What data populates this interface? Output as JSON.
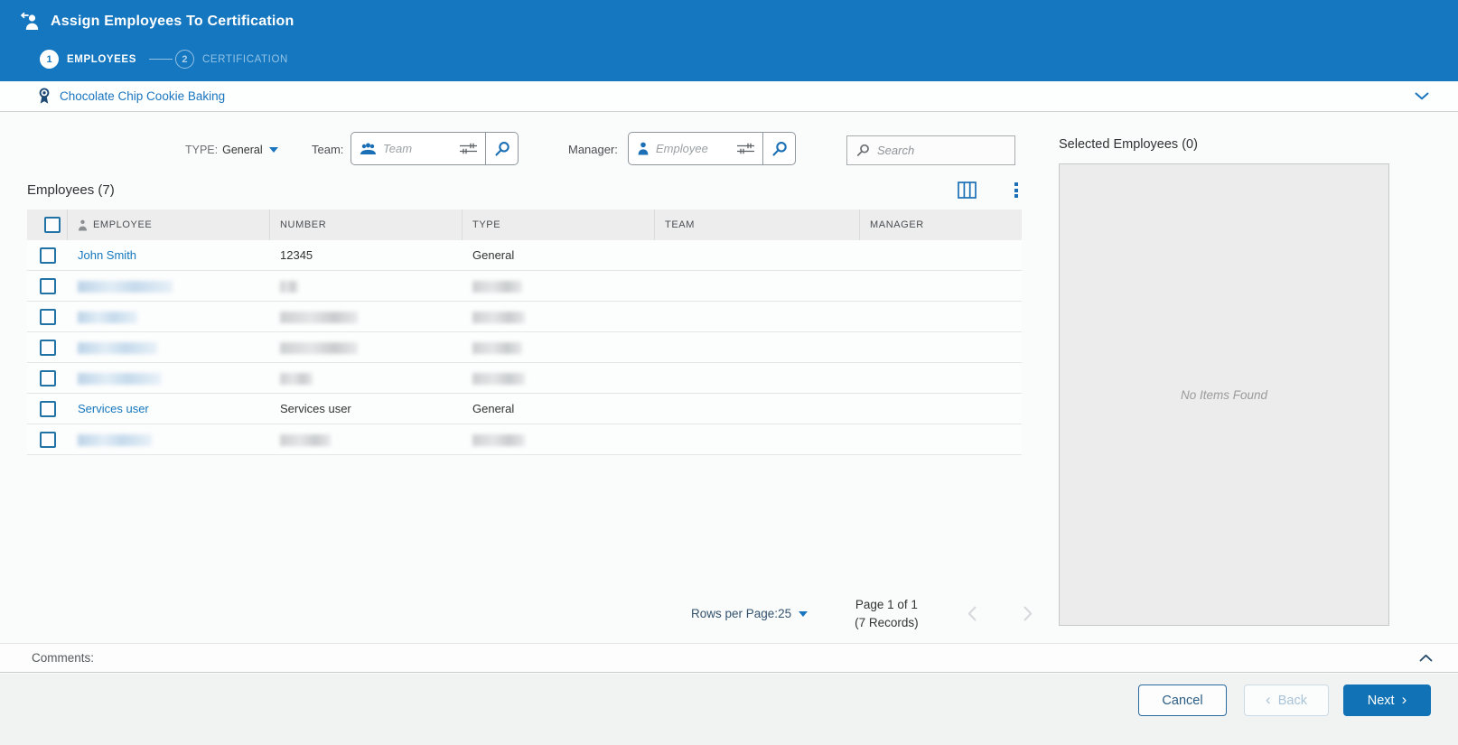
{
  "header": {
    "title": "Assign Employees To Certification",
    "steps": [
      {
        "number": "1",
        "label": "EMPLOYEES"
      },
      {
        "number": "2",
        "label": "CERTIFICATION"
      }
    ]
  },
  "certification": {
    "name": "Chocolate Chip Cookie Baking"
  },
  "filters": {
    "type_label": "TYPE:",
    "type_value": "General",
    "team_label": "Team:",
    "team_placeholder": "Team",
    "manager_label": "Manager:",
    "manager_placeholder": "Employee",
    "search_placeholder": "Search"
  },
  "table": {
    "title": "Employees (7)",
    "columns": [
      "EMPLOYEE",
      "NUMBER",
      "TYPE",
      "TEAM",
      "MANAGER"
    ],
    "rows": [
      {
        "redacted": false,
        "employee": "John Smith",
        "number": "12345",
        "type": "General",
        "team": "",
        "manager": ""
      },
      {
        "redacted": true,
        "blur": {
          "employee": 105,
          "number": 20,
          "type": 55
        }
      },
      {
        "redacted": true,
        "blur": {
          "employee": 66,
          "number": 86,
          "type": 58
        }
      },
      {
        "redacted": true,
        "blur": {
          "employee": 88,
          "number": 86,
          "type": 55
        }
      },
      {
        "redacted": true,
        "blur": {
          "employee": 92,
          "number": 36,
          "type": 58
        }
      },
      {
        "redacted": false,
        "employee": "Services user",
        "number": "Services user",
        "type": "General",
        "team": "",
        "manager": ""
      },
      {
        "redacted": true,
        "blur": {
          "employee": 82,
          "number": 56,
          "type": 58
        }
      }
    ]
  },
  "pagination": {
    "rows_per_page_label": "Rows per Page:",
    "rows_per_page_value": "25",
    "page_label": "Page 1 of 1",
    "records_label": "(7 Records)"
  },
  "selected_panel": {
    "title": "Selected Employees (0)",
    "empty_text": "No Items Found"
  },
  "comments": {
    "label": "Comments:"
  },
  "footer": {
    "cancel_label": "Cancel",
    "back_label": "Back",
    "next_label": "Next"
  },
  "colors": {
    "header_bg": "#1577c0",
    "link_blue": "#1678be",
    "icon_blue": "#1a6fb5",
    "ribbon_navy": "#1d4b75",
    "primary_button": "#1173b6",
    "disabled_chevron": "#d5d9dc"
  }
}
